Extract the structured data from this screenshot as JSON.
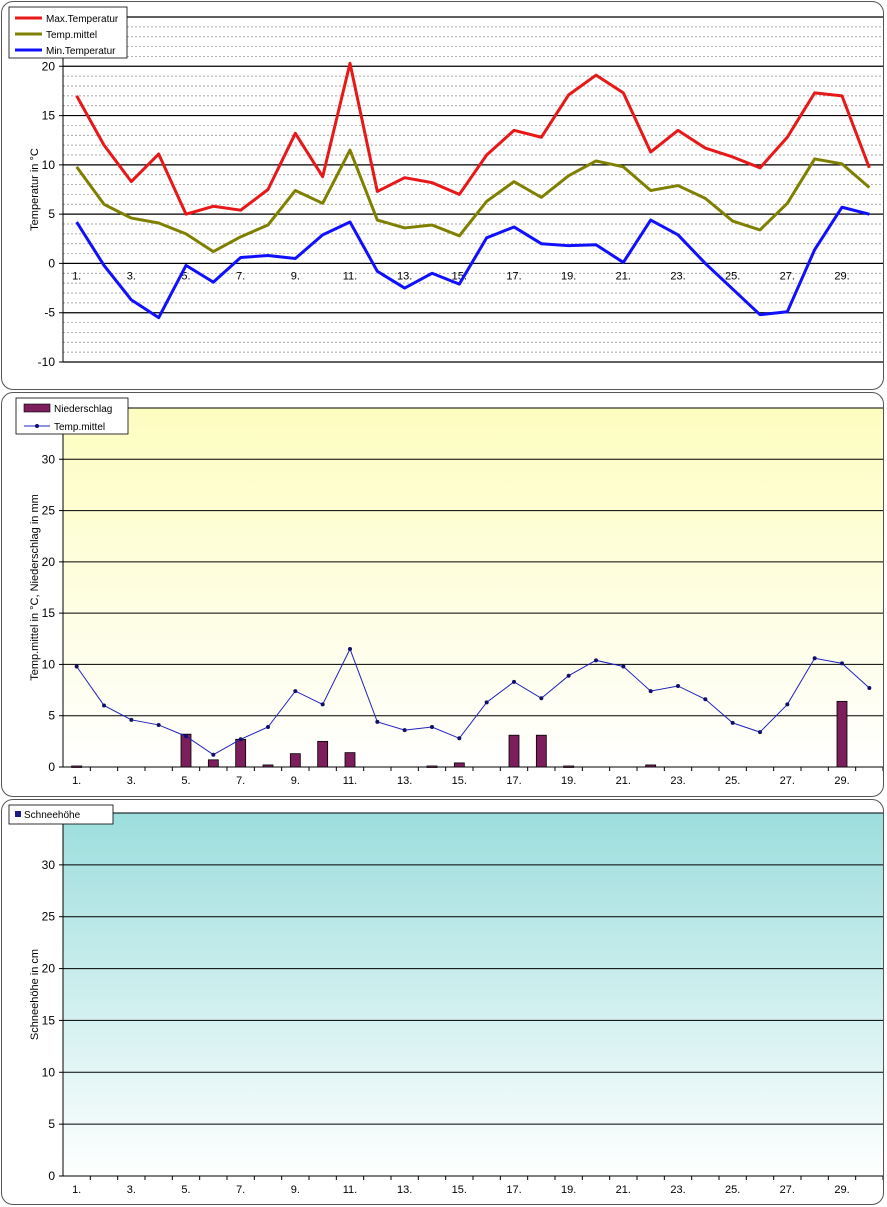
{
  "chart_data": [
    {
      "type": "line",
      "categories": [
        "1.",
        "2.",
        "3.",
        "4.",
        "5.",
        "6.",
        "7.",
        "8.",
        "9.",
        "10.",
        "11.",
        "12.",
        "13.",
        "14.",
        "15.",
        "16.",
        "17.",
        "18.",
        "19.",
        "20.",
        "21.",
        "22.",
        "23.",
        "24.",
        "25.",
        "26.",
        "27.",
        "28.",
        "29.",
        "30."
      ],
      "tick_labels": [
        "1.",
        "3.",
        "5.",
        "7.",
        "9.",
        "11.",
        "13.",
        "15.",
        "17.",
        "19.",
        "21.",
        "23.",
        "25.",
        "27.",
        "29."
      ],
      "series": [
        {
          "name": "Max.Temperatur",
          "color": "#e81818",
          "values": [
            17.0,
            12.0,
            8.3,
            11.1,
            5.0,
            5.8,
            5.4,
            7.5,
            13.2,
            8.8,
            20.3,
            7.3,
            8.7,
            8.2,
            7.0,
            11.0,
            13.5,
            12.8,
            17.1,
            19.1,
            17.3,
            11.3,
            13.5,
            11.7,
            10.8,
            9.7,
            12.8,
            17.3,
            17.0,
            9.7
          ]
        },
        {
          "name": "Temp.mittel",
          "color": "#808000",
          "values": [
            9.8,
            6.0,
            4.6,
            4.1,
            3.0,
            1.2,
            2.7,
            3.9,
            7.4,
            6.1,
            11.5,
            4.4,
            3.6,
            3.9,
            2.8,
            6.3,
            8.3,
            6.7,
            8.9,
            10.4,
            9.8,
            7.4,
            7.9,
            6.6,
            4.3,
            3.4,
            6.1,
            10.6,
            10.1,
            7.7
          ]
        },
        {
          "name": "Min.Temperatur",
          "color": "#1010ff",
          "values": [
            4.2,
            -0.2,
            -3.7,
            -5.5,
            -0.2,
            -1.9,
            0.6,
            0.8,
            0.5,
            2.9,
            4.2,
            -0.8,
            -2.5,
            -1.0,
            -2.1,
            2.6,
            3.7,
            2.0,
            1.8,
            1.9,
            0.1,
            4.4,
            2.9,
            0.0,
            -2.6,
            -5.2,
            -4.9,
            1.4,
            5.7,
            5.0
          ]
        }
      ],
      "ylabel": "Temperatur in °C",
      "ylim": [
        -10,
        25
      ],
      "yticks": [
        "20",
        "15",
        "10",
        "5",
        "0",
        "-5",
        "-10"
      ],
      "grid": true,
      "legend": "top-left"
    },
    {
      "type": "bar",
      "categories": [
        "1.",
        "2.",
        "3.",
        "4.",
        "5.",
        "6.",
        "7.",
        "8.",
        "9.",
        "10.",
        "11.",
        "12.",
        "13.",
        "14.",
        "15.",
        "16.",
        "17.",
        "18.",
        "19.",
        "20.",
        "21.",
        "22.",
        "23.",
        "24.",
        "25.",
        "26.",
        "27.",
        "28.",
        "29.",
        "30."
      ],
      "tick_labels": [
        "1.",
        "3.",
        "5.",
        "7.",
        "9.",
        "11.",
        "13.",
        "15.",
        "17.",
        "19.",
        "21.",
        "23.",
        "25.",
        "27.",
        "29."
      ],
      "series": [
        {
          "name": "Niederschlag",
          "type": "bar",
          "color": "#7b1e5b",
          "values": [
            0.1,
            0,
            0,
            0,
            3.2,
            0.7,
            2.7,
            0.2,
            1.3,
            2.5,
            1.4,
            0,
            0,
            0.1,
            0.4,
            0,
            3.1,
            3.1,
            0.1,
            0,
            0,
            0.2,
            0,
            0,
            0,
            0,
            0,
            0,
            6.4,
            0
          ]
        },
        {
          "name": "Temp.mittel",
          "type": "line",
          "color": "#2020c0",
          "values": [
            9.8,
            6.0,
            4.6,
            4.1,
            3.0,
            1.2,
            2.7,
            3.9,
            7.4,
            6.1,
            11.5,
            4.4,
            3.6,
            3.9,
            2.8,
            6.3,
            8.3,
            6.7,
            8.9,
            10.4,
            9.8,
            7.4,
            7.9,
            6.6,
            4.3,
            3.4,
            6.1,
            10.6,
            10.1,
            7.7
          ]
        }
      ],
      "ylabel": "Temp.mittel  in °C, Niederschlag in mm",
      "ylim": [
        0,
        35
      ],
      "yticks": [
        "30",
        "25",
        "20",
        "15",
        "10",
        "5",
        "0"
      ],
      "grid": true,
      "legend": "top-left"
    },
    {
      "type": "bar",
      "categories": [
        "1.",
        "2.",
        "3.",
        "4.",
        "5.",
        "6.",
        "7.",
        "8.",
        "9.",
        "10.",
        "11.",
        "12.",
        "13.",
        "14.",
        "15.",
        "16.",
        "17.",
        "18.",
        "19.",
        "20.",
        "21.",
        "22.",
        "23.",
        "24.",
        "25.",
        "26.",
        "27.",
        "28.",
        "29.",
        "30."
      ],
      "tick_labels": [
        "1.",
        "3.",
        "5.",
        "7.",
        "9.",
        "11.",
        "13.",
        "15.",
        "17.",
        "19.",
        "21.",
        "23.",
        "25.",
        "27.",
        "29."
      ],
      "series": [
        {
          "name": "Schneehöhe",
          "color": "#1a1a8c",
          "values": [
            0,
            0,
            0,
            0,
            0,
            0,
            0,
            0,
            0,
            0,
            0,
            0,
            0,
            0,
            0,
            0,
            0,
            0,
            0,
            0,
            0,
            0,
            0,
            0,
            0,
            0,
            0,
            0,
            0,
            0
          ]
        }
      ],
      "ylabel": "Schneehöhe in cm",
      "ylim": [
        0,
        35
      ],
      "yticks": [
        "30",
        "25",
        "20",
        "15",
        "10",
        "5",
        "0"
      ],
      "grid": true,
      "legend": "top-left"
    }
  ]
}
